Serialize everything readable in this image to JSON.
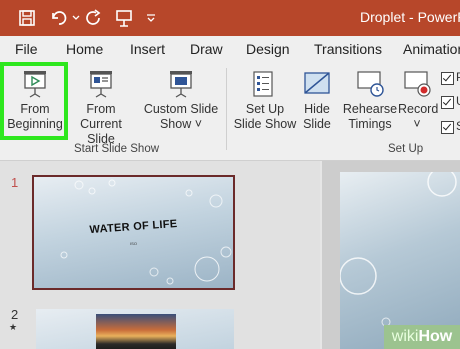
{
  "titlebar": {
    "doc_title": "Droplet - PowerPo"
  },
  "tabs": [
    "File",
    "Home",
    "Insert",
    "Draw",
    "Design",
    "Transitions",
    "Animation"
  ],
  "ribbon": {
    "from_beginning": {
      "line1": "From",
      "line2": "Beginning"
    },
    "from_current": {
      "line1": "From",
      "line2": "Current Slide"
    },
    "custom_show": {
      "line1": "Custom Slide",
      "line2": "Show ˅"
    },
    "setup_show": {
      "line1": "Set Up",
      "line2": "Slide Show"
    },
    "hide_slide": {
      "line1": "Hide",
      "line2": "Slide"
    },
    "rehearse": {
      "line1": "Rehearse",
      "line2": "Timings"
    },
    "record": {
      "line1": "Record",
      "line2": "˅"
    },
    "group_start": "Start Slide Show",
    "group_setup": "Set Up",
    "checkbox_labels": [
      "P",
      "U",
      "S"
    ]
  },
  "slides": {
    "num1": "1",
    "num2": "2",
    "star": "★",
    "thumb1_title": "WATER OF LIFE",
    "thumb1_sub": "ISO"
  },
  "watermark": {
    "wiki": "wiki",
    "how": "How"
  },
  "colors": {
    "titlebar": "#b7472a",
    "highlight": "#2ee71e",
    "active_slide_border": "#6b2a2a"
  }
}
